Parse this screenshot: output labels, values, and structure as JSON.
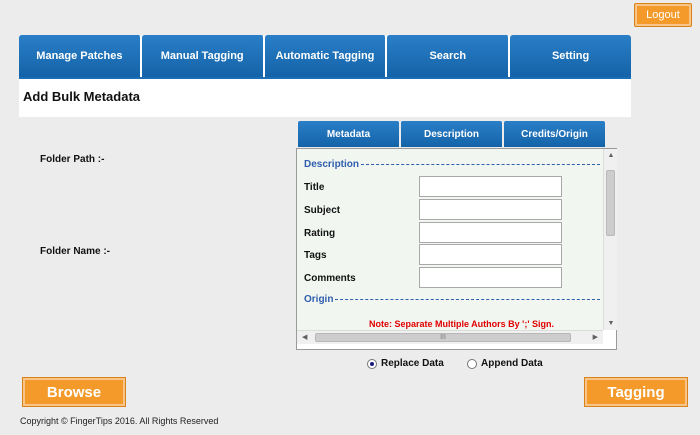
{
  "logout_label": "Logout",
  "main_tabs": [
    "Manage Patches",
    "Manual Tagging",
    "Automatic Tagging",
    "Search",
    "Setting"
  ],
  "page_title": "Add Bulk Metadata",
  "folder_path_label": "Folder Path :-",
  "folder_name_label": "Folder Name :-",
  "sub_tabs": [
    "Metadata",
    "Description",
    "Credits/Origin"
  ],
  "panel": {
    "description_heading": "Description",
    "fields": [
      {
        "label": "Title",
        "value": ""
      },
      {
        "label": "Subject",
        "value": ""
      },
      {
        "label": "Rating",
        "value": ""
      },
      {
        "label": "Tags",
        "value": ""
      },
      {
        "label": "Comments",
        "value": ""
      }
    ],
    "origin_heading": "Origin",
    "note": "Note: Separate Multiple Authors By ';' Sign.",
    "hscroll_grip": "III"
  },
  "radios": {
    "replace_label": "Replace Data",
    "replace_selected": true,
    "append_label": "Append Data",
    "append_selected": false
  },
  "browse_label": "Browse",
  "tagging_label": "Tagging",
  "footer": "Copyright © FingerTips 2016. All Rights Reserved",
  "colors": {
    "accent_blue": "#1a6fb8",
    "button_orange": "#f39a2b",
    "note_red": "#e00000",
    "heading_blue": "#2f5eae"
  }
}
